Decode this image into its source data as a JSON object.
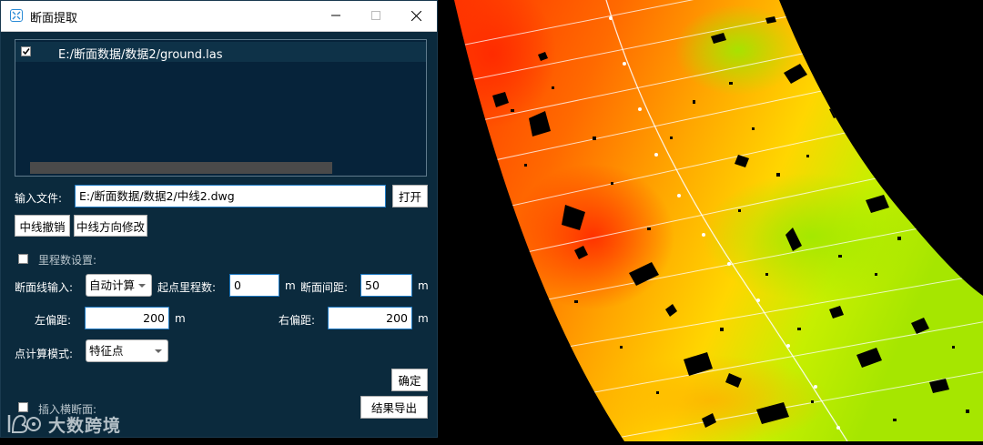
{
  "window": {
    "title": "断面提取",
    "controls": {
      "minimize": "minimize",
      "maximize": "maximize",
      "close": "close"
    }
  },
  "file_list": {
    "items": [
      {
        "checked": true,
        "path": "E:/断面数据/数据2/ground.las"
      }
    ]
  },
  "input_file": {
    "label": "输入文件:",
    "value": "E:/断面数据/数据2/中线2.dwg",
    "open_button": "打开"
  },
  "centerline": {
    "undo_button": "中线撤销",
    "direction_button": "中线方向修改"
  },
  "mileage": {
    "checkbox_label": "里程数设置:",
    "checked": false
  },
  "section_line": {
    "label": "断面线输入:",
    "mode": "自动计算",
    "start_label": "起点里程数:",
    "start_value": "0",
    "start_unit": "m",
    "interval_label": "断面间距:",
    "interval_value": "50",
    "interval_unit": "m"
  },
  "offset": {
    "left_label": "左偏距:",
    "left_value": "200",
    "left_unit": "m",
    "right_label": "右偏距:",
    "right_value": "200",
    "right_unit": "m"
  },
  "point_mode": {
    "label": "点计算模式:",
    "value": "特征点"
  },
  "confirm_button": "确定",
  "insert_cross_section": {
    "label": "插入横断面:",
    "checked": false
  },
  "export_button": "结果导出",
  "watermark": "大数跨境",
  "colors": {
    "dialog_bg": "#0b2a3d",
    "list_bg": "#06233a",
    "input_border": "#1e7ac4",
    "heat_red": "#ff3300",
    "heat_orange": "#ff8c00",
    "heat_yellow": "#ffd000",
    "heat_green": "#b8f000"
  }
}
